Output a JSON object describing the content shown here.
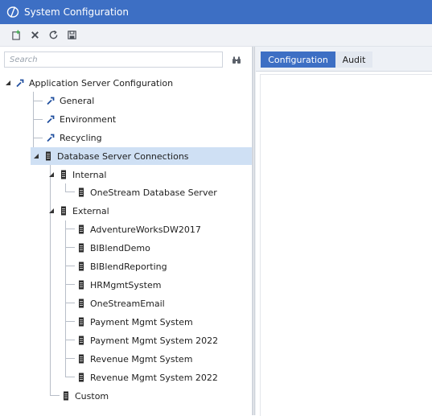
{
  "window": {
    "title": "System Configuration"
  },
  "toolbar": {
    "buttons": [
      {
        "icon": "new-icon"
      },
      {
        "icon": "delete-icon"
      },
      {
        "icon": "refresh-icon"
      },
      {
        "icon": "save-icon"
      }
    ]
  },
  "search": {
    "placeholder": "Search",
    "value": ""
  },
  "tree": {
    "root": {
      "label": "Application Server Configuration",
      "expanded": true
    },
    "general": {
      "label": "General"
    },
    "environment": {
      "label": "Environment"
    },
    "recycling": {
      "label": "Recycling"
    },
    "db_connections": {
      "label": "Database Server Connections",
      "expanded": true,
      "selected": true
    },
    "internal": {
      "label": "Internal",
      "expanded": true
    },
    "onestream_db": {
      "label": "OneStream Database Server"
    },
    "external": {
      "label": "External",
      "expanded": true
    },
    "external_items": [
      "AdventureWorksDW2017",
      "BIBlendDemo",
      "BIBlendReporting",
      "HRMgmtSystem",
      "OneStreamEmail",
      "Payment Mgmt System",
      "Payment Mgmt System 2022",
      "Revenue Mgmt System",
      "Revenue Mgmt System 2022"
    ],
    "custom": {
      "label": "Custom"
    }
  },
  "tabs": [
    {
      "label": "Configuration",
      "active": true
    },
    {
      "label": "Audit",
      "active": false
    }
  ],
  "colors": {
    "title_bar": "#3d6fc4",
    "selection": "#cfe0f4",
    "wrench": "#1f4e9e",
    "database": "#2b2b2b",
    "new_icon_accent": "#3aa84a"
  }
}
